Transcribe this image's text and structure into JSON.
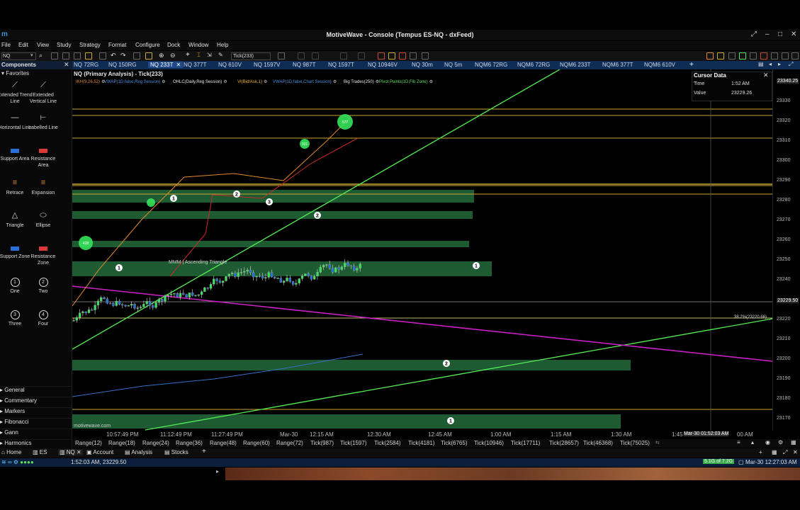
{
  "window": {
    "title": "MotiveWave - Console (Tempus ES-NQ - dxFeed)"
  },
  "menu": [
    "File",
    "Edit",
    "View",
    "Study",
    "Strategy",
    "Format",
    "Configure",
    "Dock",
    "Window",
    "Help"
  ],
  "toolbar": {
    "symbol": "NQ",
    "interval": "Tick(233)"
  },
  "chart_tabs": [
    "NQ 72RG",
    "NQ 150RG",
    "NQ 233T",
    "NQ 377T",
    "NQ 610V",
    "NQ 1597V",
    "NQ 987T",
    "NQ 1597T",
    "NQ 10946V",
    "NQ 30m",
    "NQ 5m",
    "NQM6 72RG",
    "NQM6 72RG",
    "NQM6 233T",
    "NQM6 377T",
    "NQM6 610V"
  ],
  "sidebar": {
    "title": "Components",
    "favorites": "Favorites",
    "tools": [
      {
        "label": "Extended Trend Line",
        "icon": "extended-trend-line-icon"
      },
      {
        "label": "Extended Vertical Line",
        "icon": "extended-vertical-line-icon"
      },
      {
        "label": "Horizontal Line",
        "icon": "horizontal-line-icon"
      },
      {
        "label": "Labelled Line",
        "icon": "labelled-line-icon"
      },
      {
        "label": "Support Area",
        "icon": "support-area-icon"
      },
      {
        "label": "Resistance Area",
        "icon": "resistance-area-icon"
      },
      {
        "label": "Retrace",
        "icon": "retrace-icon"
      },
      {
        "label": "Expansion",
        "icon": "expansion-icon"
      },
      {
        "label": "Triangle",
        "icon": "triangle-icon"
      },
      {
        "label": "Ellipse",
        "icon": "ellipse-icon"
      },
      {
        "label": "Support Zone",
        "icon": "support-zone-icon"
      },
      {
        "label": "Resistance Zone",
        "icon": "resistance-zone-icon"
      },
      {
        "label": "One",
        "icon": "one-icon",
        "glyph": "1"
      },
      {
        "label": "Two",
        "icon": "two-icon",
        "glyph": "2"
      },
      {
        "label": "Three",
        "icon": "three-icon",
        "glyph": "3"
      },
      {
        "label": "Four",
        "icon": "four-icon",
        "glyph": "4"
      }
    ],
    "categories": [
      "General",
      "Commentary",
      "Markers",
      "Fibonacci",
      "Gann",
      "Harmonics"
    ]
  },
  "chart": {
    "title": "NQ (Primary Analysis) - Tick(233)",
    "indicators": [
      {
        "text": "IKH(9,26,52)",
        "color": "#e08a2a"
      },
      {
        "text": "VWAP(1D,false,Reg Session)",
        "color": "#4a8fe0"
      },
      {
        "text": "OHLC(Daily,Reg Session)",
        "color": "#e8e8e8"
      },
      {
        "text": "VI(Bid/Ask,1)",
        "color": "#e8b22a"
      },
      {
        "text": "VWAP(1D,false,Chart Session)",
        "color": "#4a8fe0"
      },
      {
        "text": "Big Trades(250)",
        "color": "#e8e8e8"
      },
      {
        "text": "Pivot Points(1D,Fib Zone)",
        "color": "#5de05d"
      }
    ],
    "cursor_data": {
      "title": "Cursor Data",
      "time_label": "Time",
      "time_value": "1:52 AM",
      "value_label": "Value",
      "value_value": "23229.26"
    },
    "y_ticks": [
      "23340.25",
      "23330",
      "23320",
      "23310",
      "23300",
      "23290",
      "23280",
      "23270",
      "23260",
      "23250",
      "23240",
      "23229.50",
      "23220",
      "23210",
      "23200",
      "23190",
      "23180",
      "23170"
    ],
    "x_ticks": [
      "10:57:49 PM",
      "11:12:49 PM",
      "11:27:49 PM",
      "Mar-30",
      "12:15 AM",
      "12:30 AM",
      "12:45 AM",
      "1:00 AM",
      "1:15 AM",
      "1:30 AM",
      "1:45",
      "Mar-30 01:52:03 AM",
      "00 AM"
    ],
    "fib_label": "38.2%(23220.66)",
    "pattern_label": "MMM | Ascending Triangle",
    "big_trades": [
      "428",
      "321",
      "577"
    ],
    "markers": [
      "1",
      "2",
      "3",
      "1",
      "2",
      "1",
      "2",
      "1"
    ],
    "watermark": "motivewave.com"
  },
  "range_tabs": [
    "Range(12)",
    "Range(18)",
    "Range(24)",
    "Range(36)",
    "Range(48)",
    "Range(60)",
    "Range(72)",
    "Tick(987)",
    "Tick(1597)",
    "Tick(2584)",
    "Tick(4181)",
    "Tick(6765)",
    "Tick(10946)",
    "Tick(17711)",
    "Tick(28657)",
    "Tick(46368)",
    "Tick(75025)"
  ],
  "workspace_tabs": [
    "Home",
    "ES",
    "NQ",
    "Account",
    "Analysis",
    "Stocks"
  ],
  "status": {
    "cursor": "1:52:03 AM, 23229.50",
    "memory": "5.1G of 7.2G",
    "clock": "Mar-30 12:27:03 AM"
  },
  "colors": {
    "tab_bar": "#0f2c55",
    "zone": "#1e5a32",
    "trend": "#55ee55",
    "magenta": "#d020c8",
    "gold": "#c8a832"
  }
}
